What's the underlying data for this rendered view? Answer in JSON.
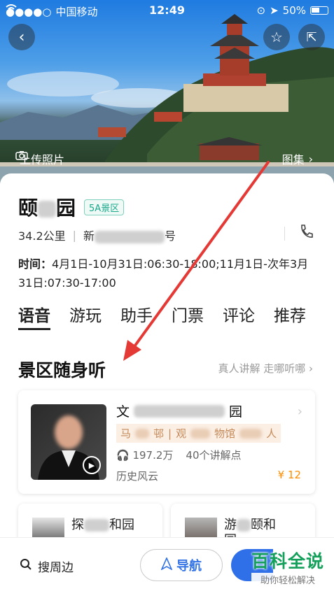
{
  "status_bar": {
    "carrier": "中国移动",
    "time": "12:49",
    "battery": "50%"
  },
  "hero": {
    "upload_label": "上传照片",
    "gallery_label": "图集"
  },
  "poi": {
    "name_start": "颐",
    "name_end": "园",
    "level_badge": "5A景区",
    "distance": "34.2公里",
    "address_start": "新",
    "address_end": "号",
    "hours_label": "时间：",
    "hours_text": "4月1日-10月31日:06:30-18:00;11月1日-次年3月31日:07:30-17:00"
  },
  "tabs": [
    "语音",
    "游玩",
    "助手",
    "门票",
    "评论",
    "推荐"
  ],
  "audio_section": {
    "title": "景区随身听",
    "link": "真人讲解 走哪听哪",
    "card": {
      "title_start": "文",
      "title_end": "园",
      "tag_start": "马",
      "tag_mid1": "邨",
      "tag_sep": "|",
      "tag_mid2": "观",
      "tag_mid3": "物馆",
      "tag_end": "人",
      "plays": "197.2万",
      "points": "40个讲解点",
      "category": "历史风云",
      "price": "¥ 12"
    },
    "mini_cards": [
      {
        "title_start": "探",
        "title_end": "和园"
      },
      {
        "title_start": "游",
        "title_end": "颐和",
        "title_line2": "园"
      }
    ]
  },
  "bottom_bar": {
    "search_nearby": "搜周边",
    "navigate": "导航"
  },
  "watermark": {
    "main": "百科全说",
    "sub": "助你轻松解决"
  },
  "colors": {
    "accent_blue": "#3474e6",
    "badge_green": "#1aa88b",
    "price_orange": "#ff8c00",
    "annotation_red": "#e53935"
  }
}
